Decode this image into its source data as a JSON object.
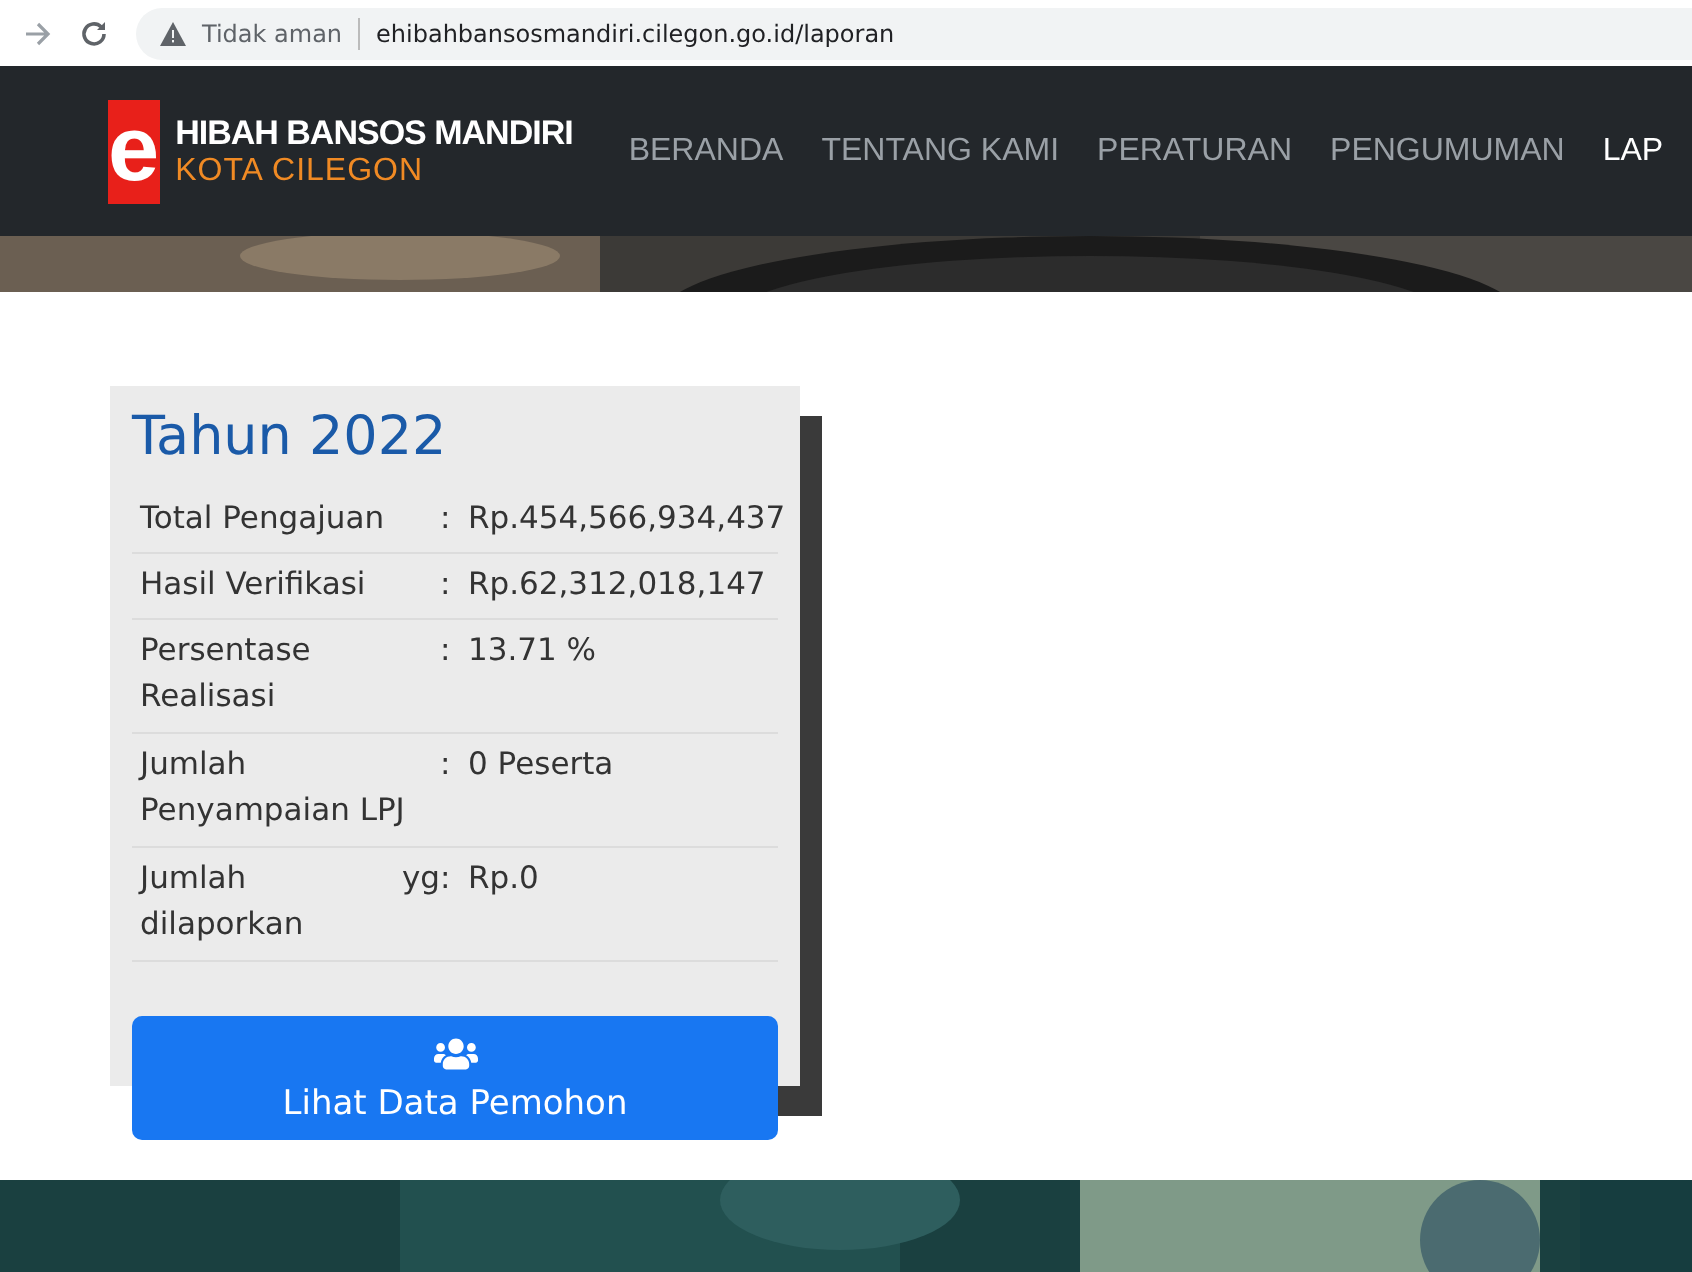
{
  "browser": {
    "security": "Tidak aman",
    "url": "ehibahbansosmandiri.cilegon.go.id/laporan"
  },
  "header": {
    "logo_letter": "e",
    "brand_title": "HIBAH BANSOS MANDIRI",
    "brand_subtitle": "KOTA CILEGON",
    "nav": [
      {
        "label": "BERANDA",
        "selected": false
      },
      {
        "label": "TENTANG KAMI",
        "selected": false
      },
      {
        "label": "PERATURAN",
        "selected": false
      },
      {
        "label": "PENGUMUMAN",
        "selected": false
      },
      {
        "label": "LAP",
        "selected": true
      }
    ]
  },
  "card": {
    "title": "Tahun 2022",
    "rows": [
      {
        "label": "Total Pengajuan",
        "value": "Rp.454,566,934,437"
      },
      {
        "label": "Hasil Verifikasi",
        "value": "Rp.62,312,018,147"
      },
      {
        "label": "Persentase Realisasi",
        "value": "13.71 %"
      },
      {
        "label": "Jumlah Penyampaian LPJ",
        "value": "0 Peserta"
      },
      {
        "label": "Jumlah yg dilaporkan",
        "value": "Rp.0"
      }
    ],
    "separator": ":",
    "button": "Lihat Data Pemohon"
  }
}
